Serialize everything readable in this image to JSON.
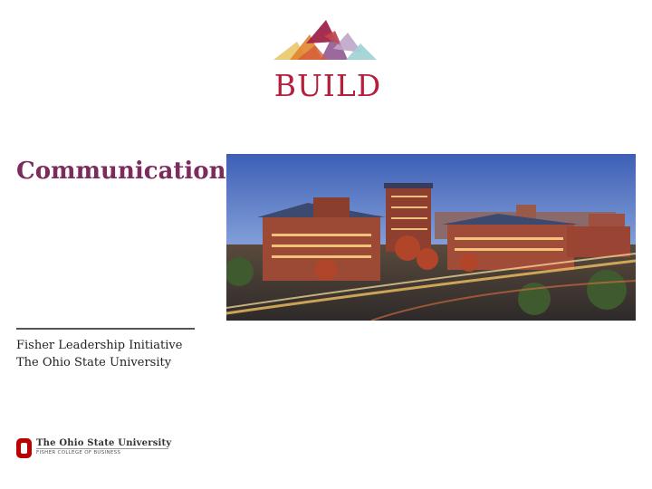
{
  "logo": {
    "wordmark": "BUILD",
    "accent_color": "#b51f3b"
  },
  "slide": {
    "title": "Communication",
    "title_color": "#7b2b5c",
    "subtitle_line1": "Fisher Leadership Initiative",
    "subtitle_line2": "The Ohio State University"
  },
  "footer": {
    "university": "The Ohio State University",
    "college": "FISHER COLLEGE OF BUSINESS",
    "block_o_color": "#bb0000"
  }
}
